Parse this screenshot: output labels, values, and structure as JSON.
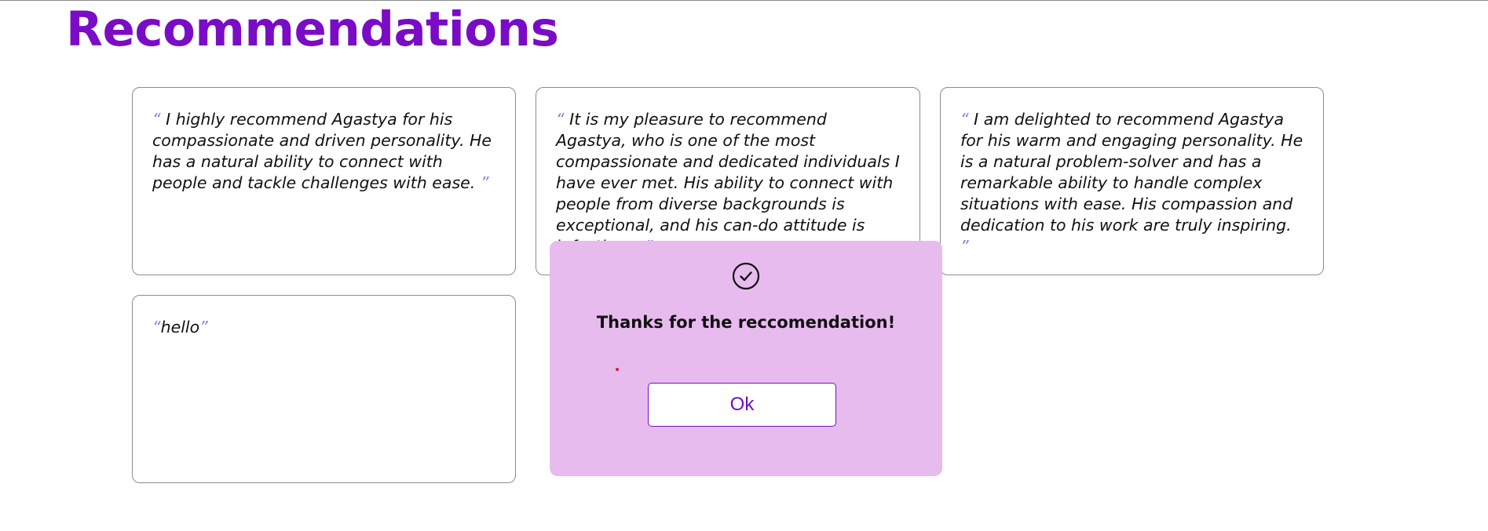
{
  "page": {
    "title": "Recommendations"
  },
  "quote_marks": {
    "open": "“",
    "close": "”"
  },
  "recommendations": [
    {
      "text": "I highly recommend Agastya for his compassionate and driven personality. He has a natural ability to connect with people and tackle challenges with ease."
    },
    {
      "text": "It is my pleasure to recommend Agastya, who is one of the most compassionate and dedicated individuals I have ever met. His ability to connect with people from diverse backgrounds is exceptional, and his can-do attitude is infectious."
    },
    {
      "text": "I am delighted to recommend Agastya for his warm and engaging personality. He is a natural problem-solver and has a remarkable ability to handle complex situations with ease. His compassion and dedication to his work are truly inspiring."
    },
    {
      "text": "hello"
    }
  ],
  "modal": {
    "icon": "check-circle-icon",
    "message": "Thanks for the reccomendation!",
    "ok_label": "Ok"
  },
  "colors": {
    "accent": "#7a0cc6",
    "modal_background": "#e8bbef",
    "quote_mark": "#9d74e0"
  }
}
